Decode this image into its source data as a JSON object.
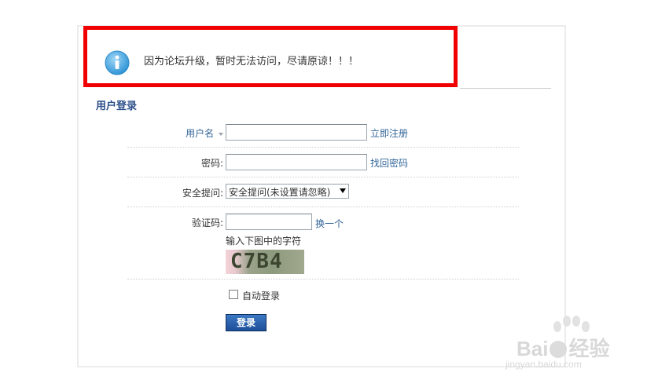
{
  "notice": {
    "message": "因为论坛升级，暂时无法访问，尽请原谅！！！",
    "icon": "info-icon"
  },
  "login": {
    "section_title": "用户登录",
    "username_label": "用户名",
    "username_value": "",
    "register_link": "立即注册",
    "password_label": "密码:",
    "password_value": "",
    "forgot_link": "找回密码",
    "question_label": "安全提问:",
    "question_selected": "安全提问(未设置请忽略)",
    "captcha_label": "验证码:",
    "captcha_value": "",
    "captcha_refresh": "换一个",
    "captcha_hint": "输入下图中的字符",
    "captcha_image_text": "C7B4",
    "autologin_label": "自动登录",
    "autologin_checked": false,
    "submit_label": "登录"
  },
  "watermark": {
    "text": "Bai",
    "text2": "经验",
    "url": "jingyan.baidu.com"
  },
  "colors": {
    "highlight_border": "#f00000",
    "accent_blue": "#336699",
    "button_blue": "#2a62b0"
  }
}
